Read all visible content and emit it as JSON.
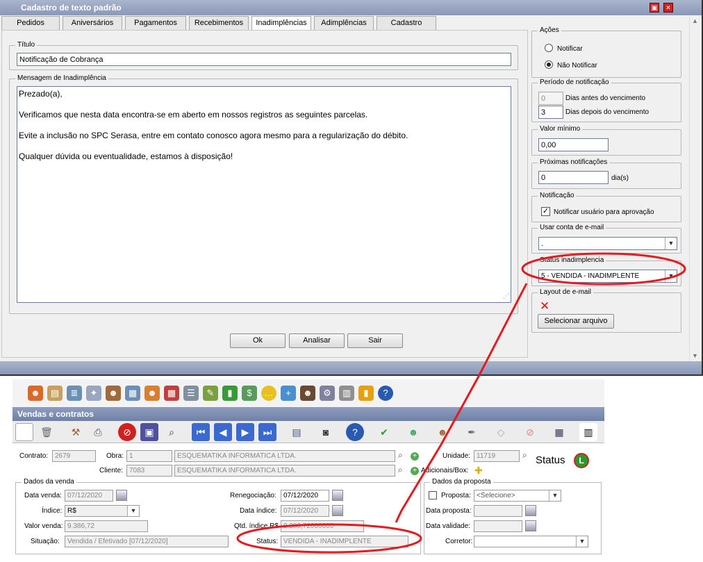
{
  "window1": {
    "title": "Cadastro de texto padrão",
    "tabs": [
      "Pedidos",
      "Aniversários",
      "Pagamentos",
      "Recebimentos",
      "Inadimplências",
      "Adimplências",
      "Cadastro"
    ],
    "active_tab": "Inadimplências",
    "titulo_legend": "Título",
    "titulo_value": "Notificação de Cobrança",
    "mensagem_legend": "Mensagem de Inadimplência",
    "mensagem_lines": [
      "Prezado(a),",
      "Verificamos que nesta data encontra-se em aberto em nossos registros as seguintes parcelas.",
      "Evite a inclusão no SPC Serasa, entre em contato conosco agora mesmo para a regularização do débito.",
      "Qualquer dúvida ou eventualidade, estamos à disposição!"
    ],
    "buttons": {
      "ok": "Ok",
      "analisar": "Analisar",
      "sair": "Sair"
    },
    "acoes": {
      "legend": "Ações",
      "notificar": "Notificar",
      "nao_notificar": "Não Notificar",
      "selected": "Não Notificar"
    },
    "periodo": {
      "legend": "Período de notificação",
      "antes_value": "0",
      "antes_label": "Dias antes do vencimento",
      "depois_value": "3",
      "depois_label": "Dias depois do vencimento"
    },
    "valor_minimo": {
      "legend": "Valor mínimo",
      "value": "0,00"
    },
    "proximas": {
      "legend": "Próximas notificações",
      "value": "0",
      "unit": "dia(s)"
    },
    "notificacao": {
      "legend": "Notificação",
      "checkbox_label": "Notificar usuário para aprovação",
      "checked": true
    },
    "conta_email": {
      "legend": "Usar conta de e-mail",
      "value": "."
    },
    "status": {
      "legend": "Status inadimplencia",
      "value": "5 - VENDIDA - INADIMPLENTE"
    },
    "layout_email": {
      "legend": "Layout de e-mail",
      "button": "Selecionar arquivo"
    }
  },
  "window2": {
    "title": "Vendas e contratos",
    "contrato_label": "Contrato:",
    "contrato": "2679",
    "obra_label": "Obra:",
    "obra_code": "1",
    "obra_name": "ESQUEMATIKA INFORMATICA LTDA.",
    "cliente_label": "Cliente:",
    "cliente_code": "7083",
    "cliente_name": "ESQUEMATIKA INFORMATICA LTDA.",
    "unidade_label": "Unidade:",
    "unidade": "11719",
    "status_label": "Status",
    "status_badge": "L",
    "adicionais_label": "Adicionais/Box:",
    "dados_venda": {
      "legend": "Dados da venda",
      "data_venda_label": "Data venda:",
      "data_venda": "07/12/2020",
      "indice_label": "Índice:",
      "indice": "R$",
      "valor_venda_label": "Valor venda:",
      "valor_venda": "9.386,72",
      "situacao_label": "Situação:",
      "situacao": "Vendida / Efetivado [07/12/2020]",
      "renegociacao_label": "Renegociação:",
      "renegociacao": "07/12/2020",
      "data_indice_label": "Data índice:",
      "data_indice": "07/12/2020",
      "qtd_indice_label": "Qtd. índice R$",
      "qtd_indice": "9.386,72000000",
      "status_label": "Status:",
      "status": "VENDIDA - INADIMPLENTE"
    },
    "dados_proposta": {
      "legend": "Dados da proposta",
      "proposta_label": "Proposta:",
      "proposta": "<Selecione>",
      "data_proposta_label": "Data proposta:",
      "data_validade_label": "Data validade:",
      "corretor_label": "Corretor:"
    }
  },
  "colors": {
    "annotation": "#e8181c",
    "title_bar": "#8a98b8"
  }
}
